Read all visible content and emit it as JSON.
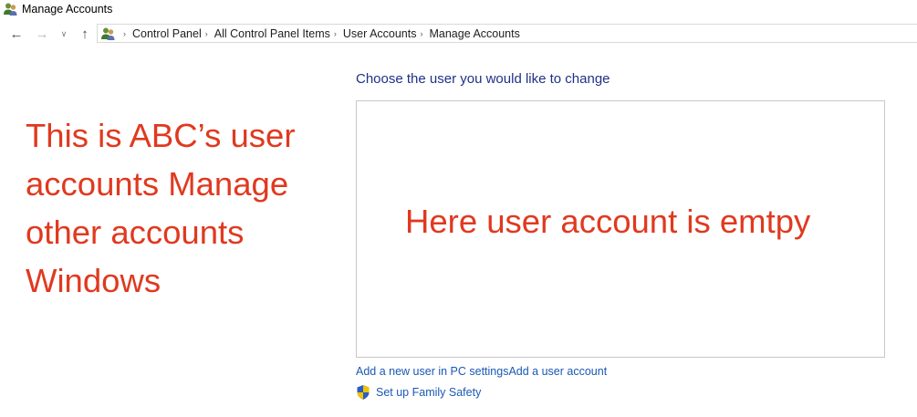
{
  "window": {
    "title": "Manage Accounts"
  },
  "nav": {
    "back_icon": "back-arrow-icon",
    "forward_icon": "forward-arrow-icon",
    "recent_icon": "chevron-down-icon",
    "up_icon": "up-arrow-icon"
  },
  "breadcrumb": {
    "items": [
      "Control Panel",
      "All Control Panel Items",
      "User Accounts",
      "Manage Accounts"
    ]
  },
  "main": {
    "heading": "Choose the user you would like to change",
    "box_annotation": "Here user account is emtpy"
  },
  "annotation": {
    "lines": [
      "This is ABC’s  user",
      "accounts Manage",
      "other accounts",
      "Windows"
    ]
  },
  "links": {
    "add_user_pc_settings": "Add a new user in PC settings",
    "add_user_account": "Add a user account",
    "family_safety": "Set up Family Safety"
  },
  "colors": {
    "annotation_red": "#e0391f",
    "heading_blue": "#1e3287",
    "link_blue": "#1a58b5"
  }
}
